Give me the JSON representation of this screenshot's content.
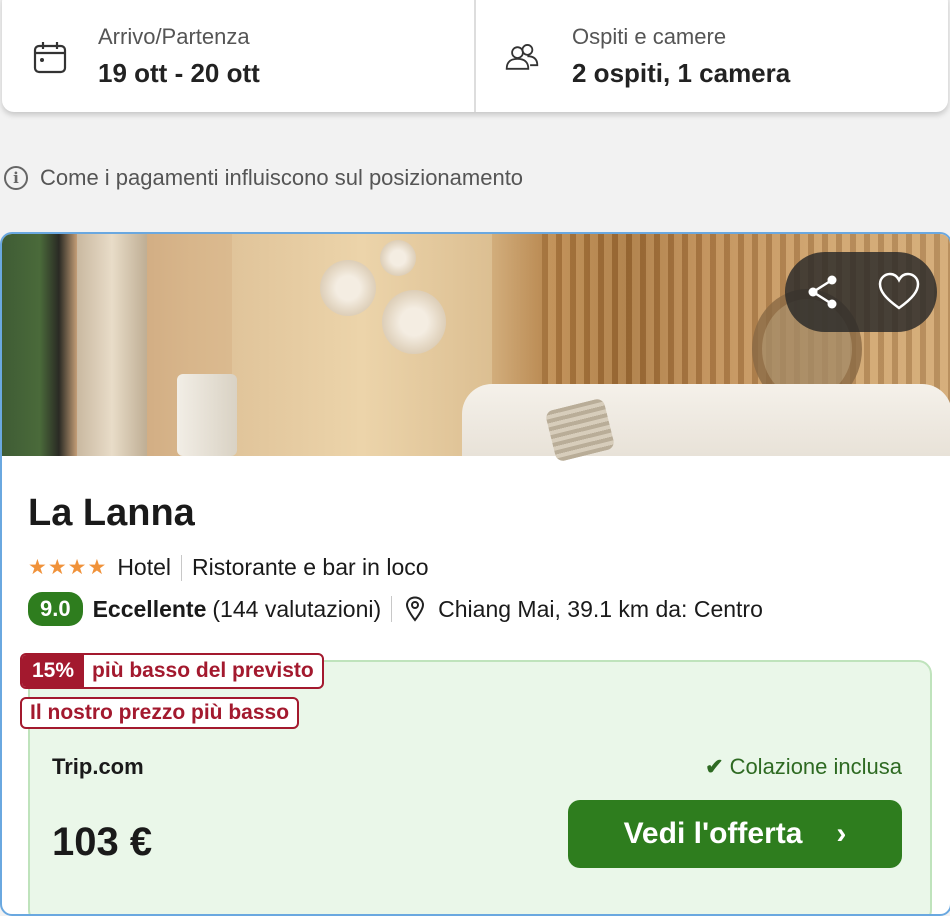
{
  "search": {
    "dates_label": "Arrivo/Partenza",
    "dates_value": "19 ott - 20 ott",
    "guests_label": "Ospiti e camere",
    "guests_value": "2 ospiti, 1 camera",
    "icons": {
      "dates": "calendar-icon",
      "guests": "users-icon"
    }
  },
  "info": {
    "text": "Come i pagamenti influiscono sul posizionamento",
    "icon": "info-icon"
  },
  "hotel": {
    "name": "La Lanna",
    "stars": "★★★★",
    "star_count": 4,
    "type": "Hotel",
    "amenity": "Ristorante e bar in loco",
    "score": "9.0",
    "rating_label": "Eccellente",
    "reviews": "(144 valutazioni)",
    "location": "Chiang Mai, 39.1 km da: Centro",
    "actions": {
      "share_icon": "share-icon",
      "favorite_icon": "heart-icon"
    }
  },
  "offer": {
    "discount_pct": "15%",
    "discount_text": "più basso del previsto",
    "lowest_price_text": "Il nostro prezzo più basso",
    "provider": "Trip.com",
    "breakfast": "Colazione inclusa",
    "price": "103 €",
    "cta_label": "Vedi l'offerta"
  },
  "colors": {
    "brand_green": "#2e7d1e",
    "deal_red": "#a3192e",
    "star_orange": "#f0923a",
    "offer_bg": "#eaf7e9"
  }
}
